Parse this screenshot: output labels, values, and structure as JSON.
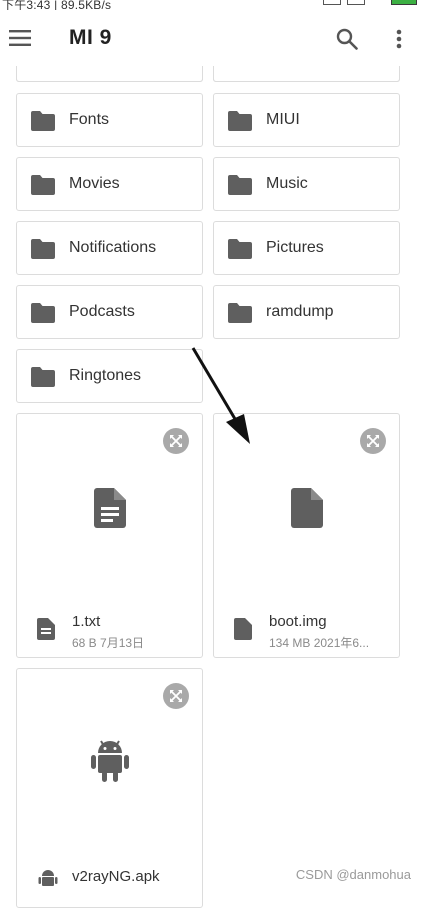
{
  "status_bar": {
    "time_speed": "下午3:43 | 89.5KB/s"
  },
  "app_bar": {
    "title": "MI 9"
  },
  "folders": [
    {
      "label": "Fonts"
    },
    {
      "label": "MIUI"
    },
    {
      "label": "Movies"
    },
    {
      "label": "Music"
    },
    {
      "label": "Notifications"
    },
    {
      "label": "Pictures"
    },
    {
      "label": "Podcasts"
    },
    {
      "label": "ramdump"
    },
    {
      "label": "Ringtones"
    }
  ],
  "files": [
    {
      "name": "1.txt",
      "meta": "68 B 7月13日",
      "icon": "text-file-icon"
    },
    {
      "name": "boot.img",
      "meta": "134 MB 2021年6...",
      "icon": "generic-file-icon"
    },
    {
      "name": "v2rayNG.apk",
      "meta": "",
      "icon": "android-icon"
    }
  ],
  "watermark": "CSDN @danmohua",
  "colors": {
    "icon_gray": "#5f5f5f",
    "border": "#dcdcdc",
    "battery_green": "#3cb043"
  }
}
